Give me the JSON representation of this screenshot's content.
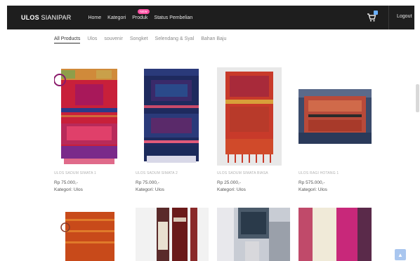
{
  "nav": {
    "brand_bold": "ULOS",
    "brand_rest": " SIANIPAR",
    "links": [
      "Home",
      "Kategori",
      "Produk",
      "Status Pembelian"
    ],
    "produk_badge": "NEW",
    "logout": "Logout"
  },
  "filters": [
    "All Products",
    "Ulos",
    "souvenir",
    "Songket",
    "Selendang & Syal",
    "Bahan Baju"
  ],
  "products": [
    {
      "name": "ULOS SADUM SIMATA 1",
      "price": "Rp 75.000,-",
      "category": "Kategori: Ulos"
    },
    {
      "name": "ULOS SADUM SIMATA 2",
      "price": "Rp 75.000,-",
      "category": "Kategori: Ulos"
    },
    {
      "name": "ULOS SADUM SIMATA BIASA",
      "price": "Rp 25.000,-",
      "category": "Kategori: Ulos"
    },
    {
      "name": "ULOS RAGI HOTANG 1",
      "price": "Rp 575.000,-",
      "category": "Kategori: Ulos"
    }
  ],
  "colors": {
    "navbar": "#1e1e1e",
    "badge": "#ff4fa3",
    "scroll_top_button": "#a9c6ef"
  },
  "icons": {
    "cart": "cart-icon",
    "scroll_top": "chevron-up-icon"
  }
}
